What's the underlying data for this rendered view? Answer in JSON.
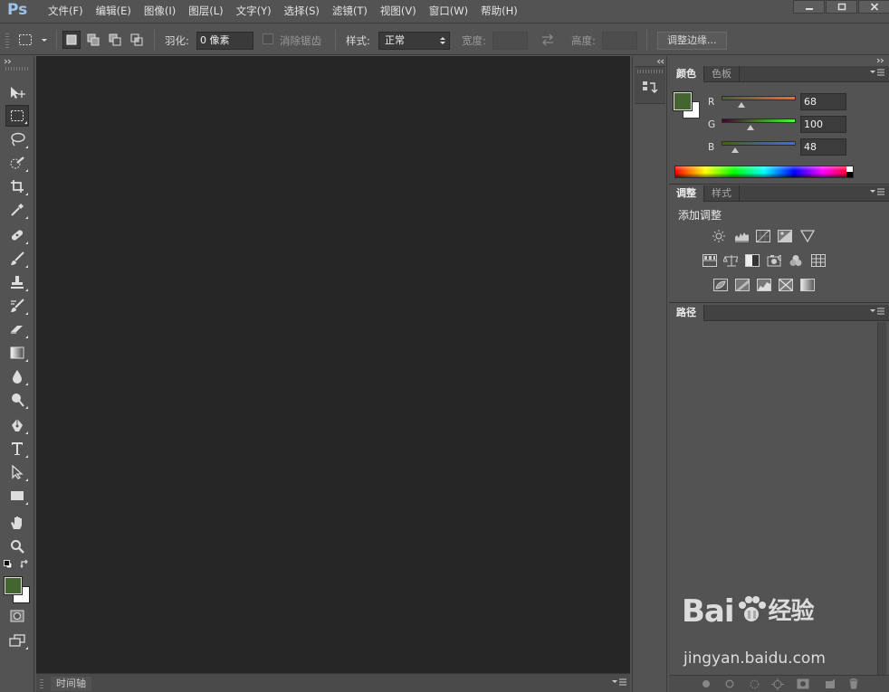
{
  "app": {
    "logo_text": "Ps"
  },
  "menu": [
    "文件(F)",
    "编辑(E)",
    "图像(I)",
    "图层(L)",
    "文字(Y)",
    "选择(S)",
    "滤镜(T)",
    "视图(V)",
    "窗口(W)",
    "帮助(H)"
  ],
  "options": {
    "feather_label": "羽化:",
    "feather_value": "0 像素",
    "antialias_label": "消除锯齿",
    "style_label": "样式:",
    "style_value": "正常",
    "width_label": "宽度:",
    "height_label": "高度:",
    "refine_edge": "调整边缘..."
  },
  "timeline": {
    "tab": "时间轴"
  },
  "color_panel": {
    "tabs": [
      "颜色",
      "色板"
    ],
    "foreground_color": "#446430",
    "background_color": "#ffffff",
    "channels": [
      {
        "label": "R",
        "value": 68,
        "max": 255,
        "gradient_from": "#446430",
        "gradient_to": "#ff6430"
      },
      {
        "label": "G",
        "value": 100,
        "max": 255,
        "gradient_from": "#440030",
        "gradient_to": "#44ff30"
      },
      {
        "label": "B",
        "value": 48,
        "max": 255,
        "gradient_from": "#446400",
        "gradient_to": "#4464ff"
      }
    ]
  },
  "adjust_panel": {
    "tabs": [
      "调整",
      "样式"
    ],
    "heading": "添加调整"
  },
  "paths_panel": {
    "tabs": [
      "路径"
    ]
  },
  "colors": {
    "canvas": "#262626",
    "panel": "#535353",
    "accent": "#9ec3ea"
  },
  "watermark": {
    "logo": "Bai",
    "logo_tail": "经验",
    "url": "jingyan.baidu.com"
  }
}
